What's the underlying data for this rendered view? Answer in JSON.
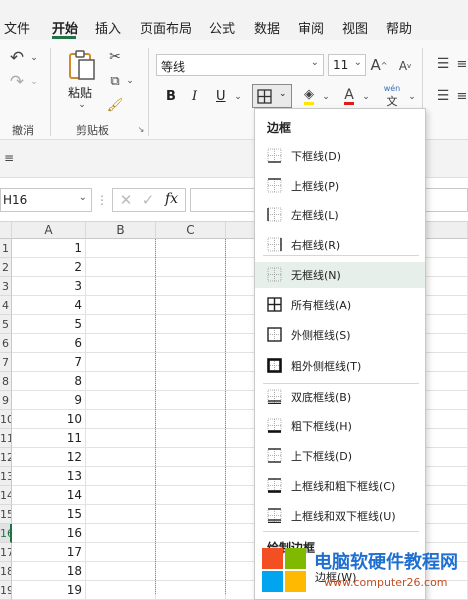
{
  "menubar": {
    "tabs": [
      {
        "label": "文件"
      },
      {
        "label": "开始"
      },
      {
        "label": "插入"
      },
      {
        "label": "页面布局"
      },
      {
        "label": "公式"
      },
      {
        "label": "数据"
      },
      {
        "label": "审阅"
      },
      {
        "label": "视图"
      },
      {
        "label": "帮助"
      }
    ],
    "active_tab": "开始"
  },
  "ribbon": {
    "paste_label": "粘贴",
    "clipboard_group": "剪贴板",
    "undo_group": "撤消",
    "font_name": "等线",
    "font_size": "11",
    "bold": "B",
    "italic": "I",
    "underline": "U"
  },
  "formula_bar": {
    "name_box": "H16",
    "fx": "fx"
  },
  "sheet": {
    "columns": [
      "A",
      "B",
      "C"
    ],
    "rows": [
      "1",
      "2",
      "3",
      "4",
      "5",
      "6",
      "7",
      "8",
      "9",
      "10",
      "11",
      "12",
      "13",
      "14",
      "15",
      "16",
      "17",
      "18",
      "19"
    ],
    "values": [
      "1",
      "2",
      "3",
      "4",
      "5",
      "6",
      "7",
      "8",
      "9",
      "10",
      "11",
      "12",
      "13",
      "14",
      "15",
      "16",
      "17",
      "18",
      "19"
    ],
    "active_row": "16"
  },
  "border_menu": {
    "title": "边框",
    "items": [
      {
        "label": "下框线(D)",
        "icon": "border-bottom-icon"
      },
      {
        "label": "上框线(P)",
        "icon": "border-top-icon"
      },
      {
        "label": "左框线(L)",
        "icon": "border-left-icon"
      },
      {
        "label": "右框线(R)",
        "icon": "border-right-icon"
      },
      {
        "label": "无框线(N)",
        "icon": "border-none-icon"
      },
      {
        "label": "所有框线(A)",
        "icon": "border-all-icon"
      },
      {
        "label": "外侧框线(S)",
        "icon": "border-outside-icon"
      },
      {
        "label": "粗外侧框线(T)",
        "icon": "border-thick-outside-icon"
      },
      {
        "label": "双底框线(B)",
        "icon": "border-double-bottom-icon"
      },
      {
        "label": "粗下框线(H)",
        "icon": "border-thick-bottom-icon"
      },
      {
        "label": "上下框线(D)",
        "icon": "border-top-bottom-icon"
      },
      {
        "label": "上框线和粗下框线(C)",
        "icon": "border-top-thick-bottom-icon"
      },
      {
        "label": "上框线和双下框线(U)",
        "icon": "border-top-double-bottom-icon"
      }
    ],
    "section2": "绘制边框",
    "partial_item": "边框(W)"
  },
  "watermark": {
    "title": "电脑软硬件教程网",
    "url": "www.computer26.com"
  }
}
